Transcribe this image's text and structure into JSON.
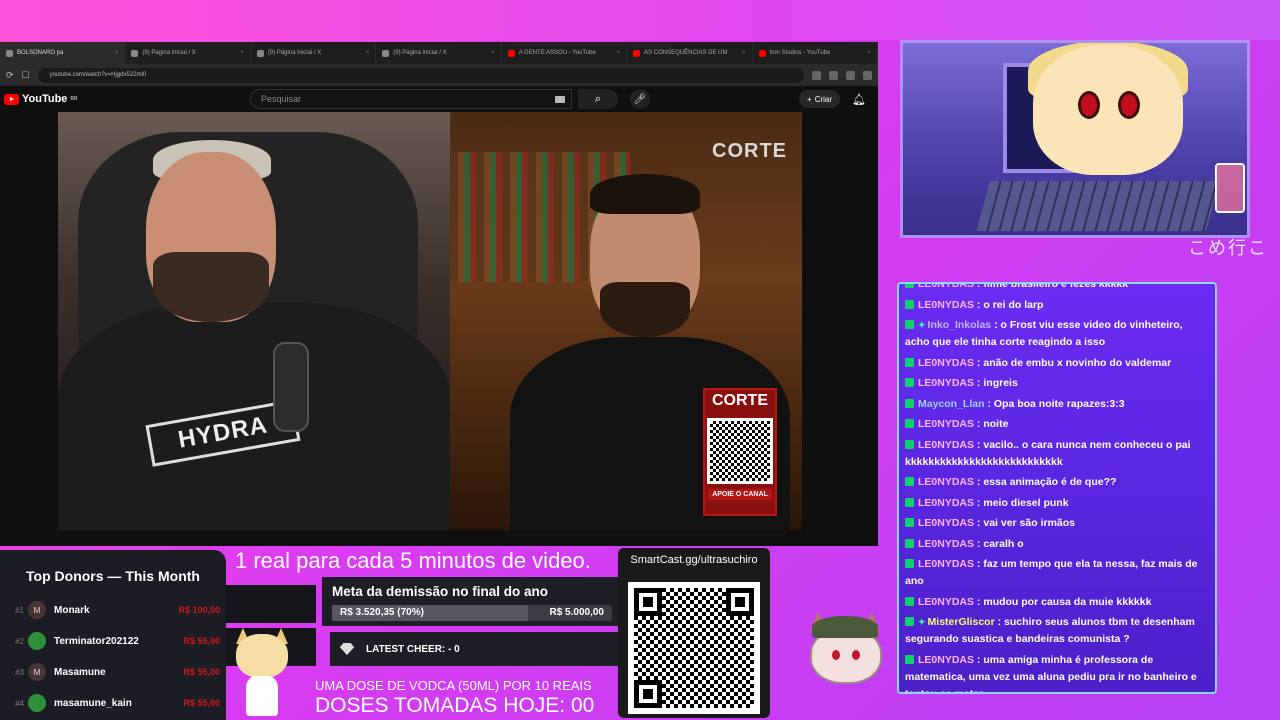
{
  "browser": {
    "tabs": [
      {
        "label": "BOLSONARO pa",
        "yt": false,
        "active": true
      },
      {
        "label": "(9) Página inicial / X",
        "yt": false,
        "active": false
      },
      {
        "label": "(9) Página inicial / X",
        "yt": false,
        "active": false
      },
      {
        "label": "(9) Página inicial / X",
        "yt": false,
        "active": false
      },
      {
        "label": "A GENTE ASSOU - YouTube",
        "yt": true,
        "active": false
      },
      {
        "label": "AS CONSEQUÊNCIAS DE UM",
        "yt": true,
        "active": false
      },
      {
        "label": "Iron Studios - YouTube",
        "yt": true,
        "active": false
      }
    ],
    "url": "youtube.com/watch?v=Hjgdv522ml0",
    "youtube": {
      "logo": "YouTube",
      "logo_suffix": "BR",
      "search_placeholder": "Pesquisar",
      "create_label": "Criar"
    }
  },
  "video": {
    "left_shirt_text": "HYDRA",
    "corte_top": "CORTE",
    "corte_panel": "CORTE",
    "corte_button": "APOIE O CANAL"
  },
  "overlay_glyphs": "こめ行こ",
  "chat": {
    "messages": [
      {
        "user": "LE0NYDAS",
        "color": "pink",
        "extra": false,
        "text": "filme brasileiro é fezes kkkkk"
      },
      {
        "user": "LE0NYDAS",
        "color": "pink",
        "extra": false,
        "text": "o rei do larp"
      },
      {
        "user": "Inko_Inkolas",
        "color": "lav",
        "extra": true,
        "text": "o Frost viu esse video do vinheteiro, acho que ele tinha corte reagindo a isso"
      },
      {
        "user": "LE0NYDAS",
        "color": "pink",
        "extra": false,
        "text": "anão de embu x novinho do valdemar"
      },
      {
        "user": "LE0NYDAS",
        "color": "pink",
        "extra": false,
        "text": "ingreis"
      },
      {
        "user": "Maycon_Llan",
        "color": "blue",
        "extra": false,
        "text": "Opa boa noite rapazes:3:3"
      },
      {
        "user": "LE0NYDAS",
        "color": "pink",
        "extra": false,
        "text": "noite"
      },
      {
        "user": "LE0NYDAS",
        "color": "pink",
        "extra": false,
        "text": "vacilo.. o cara nunca nem conheceu o pai kkkkkkkkkkkkkkkkkkkkkkkkkkk"
      },
      {
        "user": "LE0NYDAS",
        "color": "pink",
        "extra": false,
        "text": "essa animação é de que??"
      },
      {
        "user": "LE0NYDAS",
        "color": "pink",
        "extra": false,
        "text": "meio diesel punk"
      },
      {
        "user": "LE0NYDAS",
        "color": "pink",
        "extra": false,
        "text": "vai ver são irmãos"
      },
      {
        "user": "LE0NYDAS",
        "color": "pink",
        "extra": false,
        "text": "caralh o"
      },
      {
        "user": "LE0NYDAS",
        "color": "pink",
        "extra": false,
        "text": "faz um tempo que ela ta nessa, faz mais de ano"
      },
      {
        "user": "LE0NYDAS",
        "color": "pink",
        "extra": false,
        "text": "mudou por causa da muie kkkkkk"
      },
      {
        "user": "MisterGliscor",
        "color": "yellow",
        "extra": true,
        "text": "suchiro seus alunos tbm te desenham segurando suastica e bandeiras comunista ?"
      },
      {
        "user": "LE0NYDAS",
        "color": "pink",
        "extra": false,
        "text": "uma amiga minha é professora de matematica, uma vez uma aluna pediu pra ir no banheiro e tentou se matar"
      }
    ]
  },
  "donors": {
    "title": "Top Donors — This Month",
    "list": [
      {
        "rank": "#1",
        "initial": "M",
        "green": false,
        "name": "Monark",
        "amount": "R$ 100,00"
      },
      {
        "rank": "#2",
        "initial": "",
        "green": true,
        "name": "Terminator202122",
        "amount": "R$ 55,00"
      },
      {
        "rank": "#3",
        "initial": "M",
        "green": false,
        "name": "Masamune",
        "amount": "R$ 55,00"
      },
      {
        "rank": "#4",
        "initial": "",
        "green": true,
        "name": "masamune_kain",
        "amount": "R$ 55,00"
      }
    ]
  },
  "marquee": "1 real para cada 5 minutos de video.",
  "goal": {
    "title": "Meta da demissão no final do ano",
    "current": "R$ 3.520,35 (70%)",
    "target": "R$ 5.000,00",
    "progress": 0.7
  },
  "cheer": {
    "label": "LATEST CHEER:  - 0"
  },
  "vodka": {
    "line1": "UMA DOSE DE VODCA (50ML) POR 10 REAIS",
    "line2": "DOSES TOMADAS HOJE: 00"
  },
  "qr": {
    "url": "SmartCast.gg/ultrasuchiro"
  },
  "colors": {
    "accent": "#d93cf0",
    "chat_bg": "#5a26e0",
    "donation_red": "#d01818"
  }
}
